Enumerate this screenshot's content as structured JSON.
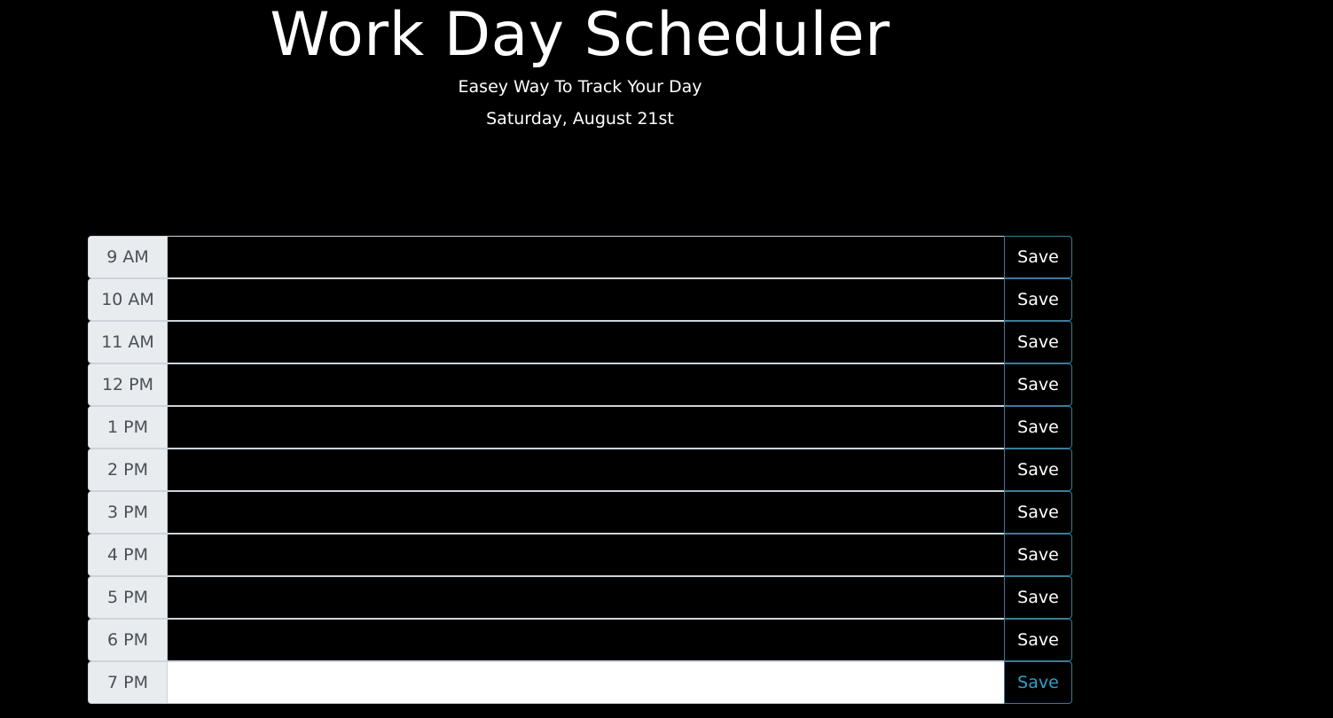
{
  "header": {
    "title": "Work Day Scheduler",
    "subtitle": "Easey Way To Track Your Day",
    "current_day": "Saturday, August 21st"
  },
  "schedule": {
    "save_label": "Save",
    "rows": [
      {
        "hour": "9 AM",
        "task": ""
      },
      {
        "hour": "10 AM",
        "task": ""
      },
      {
        "hour": "11 AM",
        "task": ""
      },
      {
        "hour": "12 PM",
        "task": ""
      },
      {
        "hour": "1 PM",
        "task": ""
      },
      {
        "hour": "2 PM",
        "task": ""
      },
      {
        "hour": "3 PM",
        "task": ""
      },
      {
        "hour": "4 PM",
        "task": ""
      },
      {
        "hour": "5 PM",
        "task": ""
      },
      {
        "hour": "6 PM",
        "task": ""
      },
      {
        "hour": "7 PM",
        "task": ""
      }
    ]
  },
  "colors": {
    "background": "#000000",
    "hour_background": "#e9ecef",
    "past_task": "#000000",
    "future_task": "#ffffff",
    "save_border": "#3b7d99",
    "future_save_text": "#2fa0c8"
  }
}
